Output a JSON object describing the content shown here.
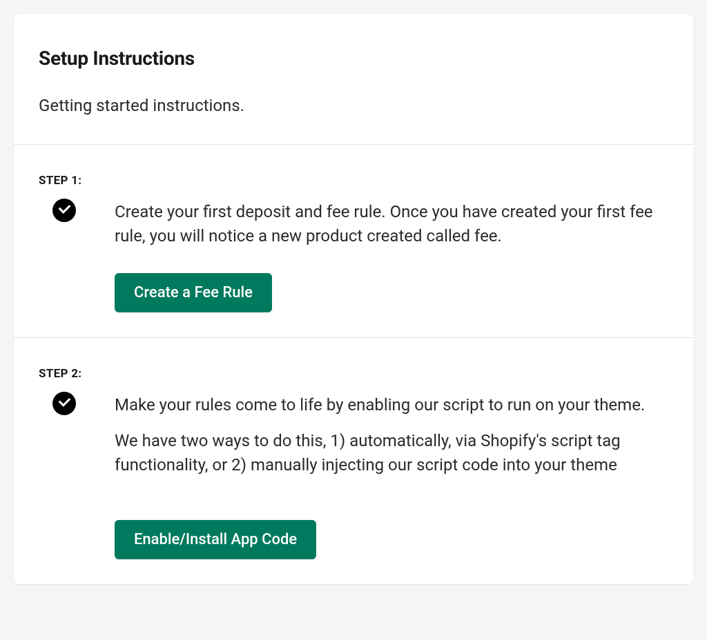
{
  "header": {
    "title": "Setup Instructions",
    "subtitle": "Getting started instructions."
  },
  "steps": [
    {
      "label": "STEP 1:",
      "text1": "Create your first deposit and fee rule. Once you have created your first fee rule, you will notice a new product created called fee.",
      "button": "Create a Fee Rule"
    },
    {
      "label": "STEP 2:",
      "text1": "Make your rules come to life by enabling our script to run on your theme.",
      "text2": "We have two ways to do this, 1) automatically, via Shopify's script tag functionality, or 2) manually injecting our script code into your theme",
      "button": "Enable/Install App Code"
    }
  ]
}
